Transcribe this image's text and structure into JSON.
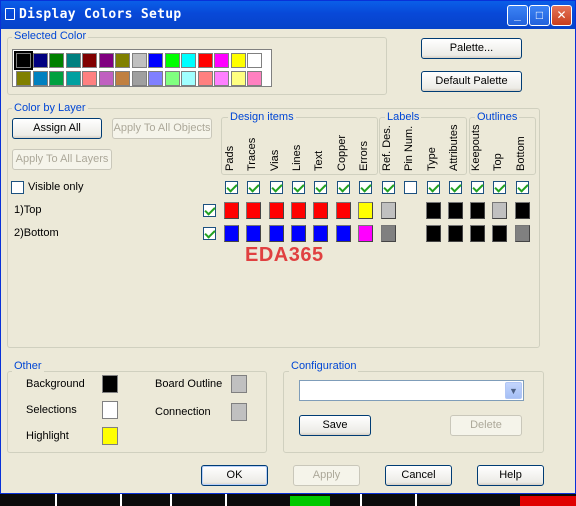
{
  "window": {
    "title": "Display Colors Setup",
    "minimize_icon": "minimize-icon",
    "maximize_icon": "maximize-icon",
    "close_icon": "close-icon"
  },
  "selected_color": {
    "label": "Selected Color",
    "palette_rows": [
      [
        "#000000",
        "#000080",
        "#008000",
        "#008080",
        "#800000",
        "#800080",
        "#808000",
        "#C0C0C0",
        "#0000FF",
        "#00FF00",
        "#00FFFF",
        "#FF0000",
        "#FF00FF",
        "#FFFF00",
        "#FFFFFF"
      ],
      [
        "#808000",
        "#0080C0",
        "#00A040",
        "#00A0A0",
        "#FF8080",
        "#C060C0",
        "#C08040",
        "#A0A0A0",
        "#8080FF",
        "#80FF80",
        "#A0FFFF",
        "#FF8080",
        "#FF80FF",
        "#FFFF80",
        "#FF80C0"
      ]
    ],
    "selected_index": 0
  },
  "buttons": {
    "palette": "Palette...",
    "default_palette": "Default Palette",
    "assign_all": "Assign All",
    "apply_all_objects": "Apply To All Objects",
    "apply_all_layers": "Apply To All Layers",
    "save": "Save",
    "delete": "Delete",
    "ok": "OK",
    "apply": "Apply",
    "cancel": "Cancel",
    "help": "Help"
  },
  "color_by_layer": {
    "label": "Color by Layer",
    "visible_only": "Visible only",
    "visible_only_checked": false,
    "groups": {
      "design_items": "Design items",
      "labels": "Labels",
      "outlines": "Outlines"
    },
    "columns": [
      {
        "name": "Pads",
        "checked": true
      },
      {
        "name": "Traces",
        "checked": true
      },
      {
        "name": "Vias",
        "checked": true
      },
      {
        "name": "Lines",
        "checked": true
      },
      {
        "name": "Text",
        "checked": true
      },
      {
        "name": "Copper",
        "checked": true
      },
      {
        "name": "Errors",
        "checked": true
      },
      {
        "name": "Ref. Des.",
        "checked": true
      },
      {
        "name": "Pin Num.",
        "checked": false
      },
      {
        "name": "Type",
        "checked": true
      },
      {
        "name": "Attributes",
        "checked": true
      },
      {
        "name": "Keepouts",
        "checked": true
      },
      {
        "name": "Top",
        "checked": true
      },
      {
        "name": "Bottom",
        "checked": true
      }
    ],
    "layers": [
      {
        "name": "1)Top",
        "checked": true,
        "colors": [
          "#FF0000",
          "#FF0000",
          "#FF0000",
          "#FF0000",
          "#FF0000",
          "#FF0000",
          "#FFFF00",
          "#C0C0C0",
          null,
          "#000000",
          "#000000",
          "#000000",
          "#C0C0C0",
          "#000000"
        ]
      },
      {
        "name": "2)Bottom",
        "checked": true,
        "colors": [
          "#0000FF",
          "#0000FF",
          "#0000FF",
          "#0000FF",
          "#0000FF",
          "#0000FF",
          "#FF00FF",
          "#808080",
          null,
          "#000000",
          "#000000",
          "#000000",
          "#000000",
          "#808080"
        ]
      }
    ]
  },
  "watermark": "EDA365",
  "other": {
    "label": "Other",
    "background": {
      "label": "Background",
      "color": "#000000"
    },
    "selections": {
      "label": "Selections",
      "color": "#FFFFFF"
    },
    "highlight": {
      "label": "Highlight",
      "color": "#FFFF00"
    },
    "board_outline": {
      "label": "Board Outline",
      "color": "#C0C0C0"
    },
    "connection": {
      "label": "Connection",
      "color": "#C0C0C0"
    }
  },
  "configuration": {
    "label": "Configuration",
    "selected_value": ""
  }
}
